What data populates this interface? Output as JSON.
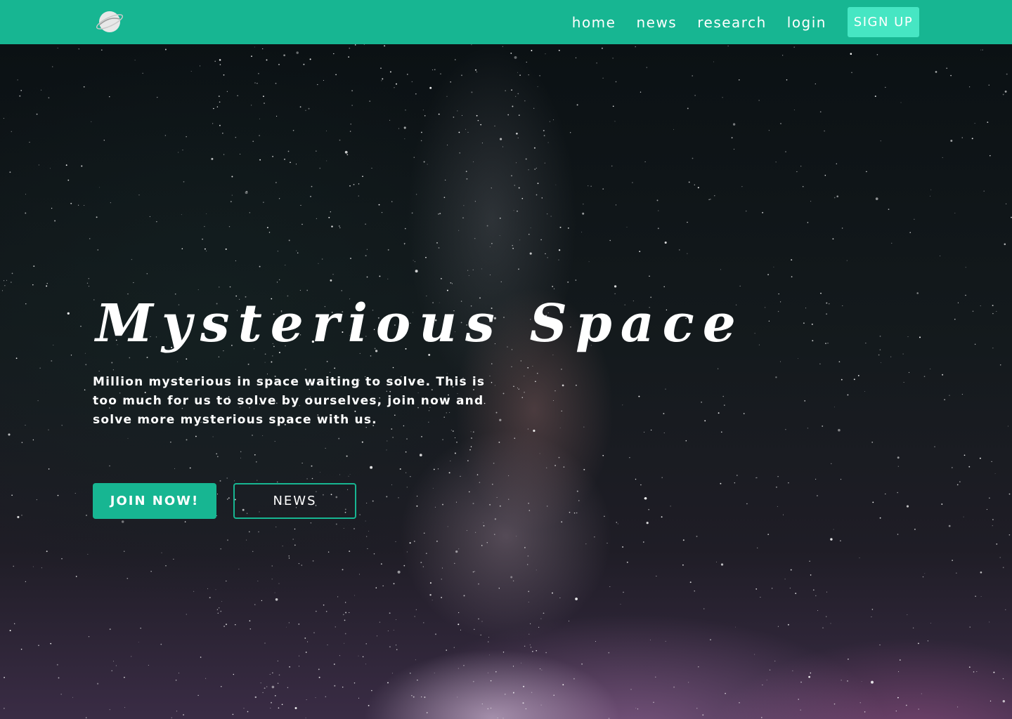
{
  "nav": {
    "logo_icon": "planet-icon",
    "links": [
      "home",
      "news",
      "research",
      "login"
    ],
    "signup_label": "SIGN UP"
  },
  "hero": {
    "title": "Mysterious Space",
    "description": "Million mysterious in space waiting to solve. This is too much for us to solve by ourselves, join now and solve more mysterious space with us.",
    "join_label": "JOIN NOW!",
    "news_label": "NEWS"
  },
  "colors": {
    "brand": "#17b692",
    "signup": "#46e6c3",
    "text": "#ffffff"
  }
}
